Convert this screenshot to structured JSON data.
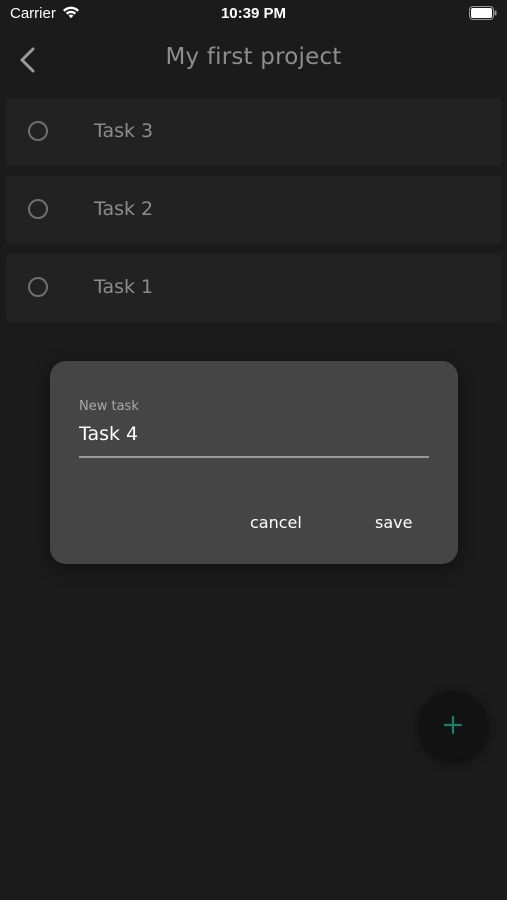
{
  "status_bar": {
    "carrier": "Carrier",
    "time": "10:39 PM",
    "icons": [
      "wifi-icon",
      "battery-icon"
    ]
  },
  "nav": {
    "back_icon": "chevron-left-icon",
    "title": "My first project"
  },
  "tasks": [
    {
      "label": "Task 3",
      "done": false
    },
    {
      "label": "Task 2",
      "done": false
    },
    {
      "label": "Task 1",
      "done": false
    }
  ],
  "dialog": {
    "field_label": "New task",
    "field_value": "Task 4",
    "cancel_label": "cancel",
    "save_label": "save"
  },
  "fab": {
    "icon": "plus-icon",
    "icon_color": "#1f7a6a"
  },
  "colors": {
    "background": "#1b1b1b",
    "list_item": "#222222",
    "dialog": "#454545",
    "fab": "#121212",
    "accent": "#1f7a6a"
  }
}
